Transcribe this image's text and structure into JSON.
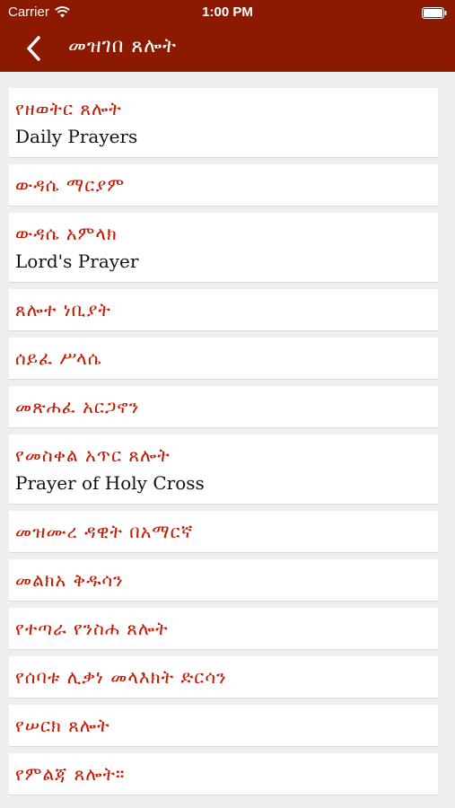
{
  "status_bar": {
    "carrier": "Carrier",
    "time": "1:00 PM"
  },
  "nav": {
    "title": "መዝገበ ጸሎት",
    "back_icon": "chevron-left-icon"
  },
  "colors": {
    "brand": "#8b1a00",
    "item_title": "#c21a00",
    "background": "#eeeeee"
  },
  "prayers": [
    {
      "am": "የዘወትር ጸሎት",
      "en": "Daily Prayers"
    },
    {
      "am": "ውዳሴ ማርያም",
      "en": ""
    },
    {
      "am": "ውዳሴ አምላክ",
      "en": "Lord's Prayer"
    },
    {
      "am": "ጸሎተ ነቢያት",
      "en": ""
    },
    {
      "am": "ሰይፈ ሥላሴ",
      "en": ""
    },
    {
      "am": "መጽሐፈ አርጋኖን",
      "en": ""
    },
    {
      "am": "የመስቀል አጥር ጸሎት",
      "en": "Prayer of Holy Cross"
    },
    {
      "am": "መዝሙረ ዳዊት በአማርኛ",
      "en": ""
    },
    {
      "am": "መልክአ ቅዱሳን",
      "en": ""
    },
    {
      "am": "የተጣራ የንስሐ ጸሎት",
      "en": ""
    },
    {
      "am": "የሰባቱ ሊቃነ መላእክት ድርሳን",
      "en": ""
    },
    {
      "am": "የሠርክ ጸሎት",
      "en": ""
    },
    {
      "am": "የምልጃ ጸሎት።",
      "en": ""
    }
  ]
}
